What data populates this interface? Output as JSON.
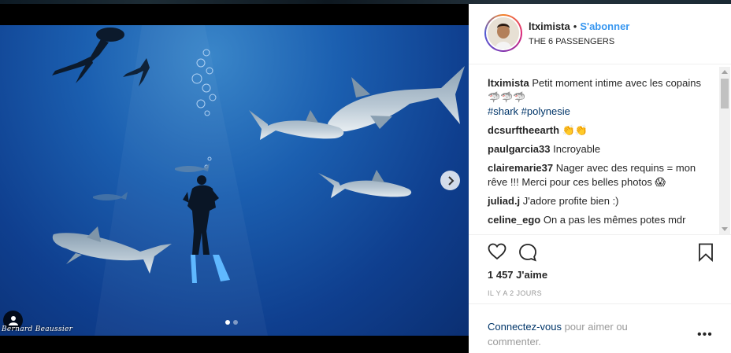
{
  "header": {
    "username": "ltximista",
    "separator": "•",
    "follow_label": "S'abonner",
    "location": "THE 6 PASSENGERS"
  },
  "caption": {
    "username": "ltximista",
    "text": "Petit moment intime avec les copains 🦈🦈🦈",
    "hashtags": [
      "#shark",
      "#polynesie"
    ]
  },
  "comments": [
    {
      "username": "dcsurftheearth",
      "text": "👏👏"
    },
    {
      "username": "paulgarcia33",
      "text": "Incroyable"
    },
    {
      "username": "clairemarie37",
      "text": "Nager avec des requins = mon rêve !!! Merci pour ces belles photos 😱"
    },
    {
      "username": "juliad.j",
      "text": "J'adore profite bien :)"
    },
    {
      "username": "celine_ego",
      "text": "On a pas les mêmes potes mdr"
    }
  ],
  "likes": "1 457 J'aime",
  "timestamp": "IL Y A 2 JOURS",
  "login_prompt": {
    "link": "Connectez-vous",
    "text": " pour aimer ou commenter."
  },
  "more_label": "•••",
  "photo": {
    "credit": "Bernard Beaussier",
    "carousel_total": 2,
    "carousel_active": 1
  },
  "icons": {
    "like": "heart-icon",
    "comment": "comment-icon",
    "save": "bookmark-icon",
    "next": "chevron-right-icon",
    "tag": "user-tag-icon"
  },
  "colors": {
    "accent": "#3897f0",
    "hashtag": "#003569",
    "muted": "#999999",
    "text": "#262626"
  }
}
